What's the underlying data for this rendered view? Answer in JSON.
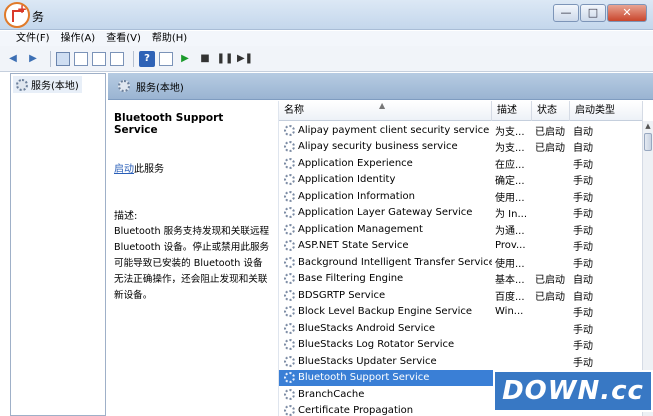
{
  "window": {
    "title": "服务",
    "title_visible": "务",
    "minimize": "—",
    "maximize": "□",
    "close": "✕"
  },
  "menu": [
    {
      "label": "文件(F)"
    },
    {
      "label": "操作(A)"
    },
    {
      "label": "查看(V)"
    },
    {
      "label": "帮助(H)"
    }
  ],
  "toolbar": {
    "back": "◀",
    "forward": "▶",
    "help": "?",
    "start": "▶",
    "stop": "■",
    "pause": "❚❚",
    "restart": "▶❚"
  },
  "tree": {
    "root_label": "服务(本地)"
  },
  "panel": {
    "header": "服务(本地)"
  },
  "details": {
    "service_name": "Bluetooth Support Service",
    "action_link": "启动",
    "action_suffix": "此服务",
    "desc_label": "描述:",
    "desc_text": "Bluetooth 服务支持发现和关联远程 Bluetooth 设备。停止或禁用此服务可能导致已安装的 Bluetooth 设备无法正确操作，还会阻止发现和关联新设备。"
  },
  "columns": {
    "name": "名称",
    "desc": "描述",
    "status": "状态",
    "startup": "启动类型"
  },
  "services": [
    {
      "name": "Alipay payment client security service",
      "desc": "为支...",
      "status": "已启动",
      "startup": "自动"
    },
    {
      "name": "Alipay security business service",
      "desc": "为支...",
      "status": "已启动",
      "startup": "自动"
    },
    {
      "name": "Application Experience",
      "desc": "在应...",
      "status": "",
      "startup": "手动"
    },
    {
      "name": "Application Identity",
      "desc": "确定...",
      "status": "",
      "startup": "手动"
    },
    {
      "name": "Application Information",
      "desc": "使用...",
      "status": "",
      "startup": "手动"
    },
    {
      "name": "Application Layer Gateway Service",
      "desc": "为 In...",
      "status": "",
      "startup": "手动"
    },
    {
      "name": "Application Management",
      "desc": "为通...",
      "status": "",
      "startup": "手动"
    },
    {
      "name": "ASP.NET State Service",
      "desc": "Prov...",
      "status": "",
      "startup": "手动"
    },
    {
      "name": "Background Intelligent Transfer Service",
      "desc": "使用...",
      "status": "",
      "startup": "手动"
    },
    {
      "name": "Base Filtering Engine",
      "desc": "基本...",
      "status": "已启动",
      "startup": "自动"
    },
    {
      "name": "BDSGRTP Service",
      "desc": "百度...",
      "status": "已启动",
      "startup": "自动"
    },
    {
      "name": "Block Level Backup Engine Service",
      "desc": "Win...",
      "status": "",
      "startup": "手动"
    },
    {
      "name": "BlueStacks Android Service",
      "desc": "",
      "status": "",
      "startup": "手动"
    },
    {
      "name": "BlueStacks Log Rotator Service",
      "desc": "",
      "status": "",
      "startup": "手动"
    },
    {
      "name": "BlueStacks Updater Service",
      "desc": "",
      "status": "",
      "startup": "手动"
    },
    {
      "name": "Bluetooth Support Service",
      "desc": "",
      "status": "",
      "startup": "",
      "selected": true
    },
    {
      "name": "BranchCache",
      "desc": "",
      "status": "",
      "startup": ""
    },
    {
      "name": "Certificate Propagation",
      "desc": "",
      "status": "",
      "startup": ""
    }
  ],
  "watermark": {
    "text": "DOWN.cc"
  }
}
